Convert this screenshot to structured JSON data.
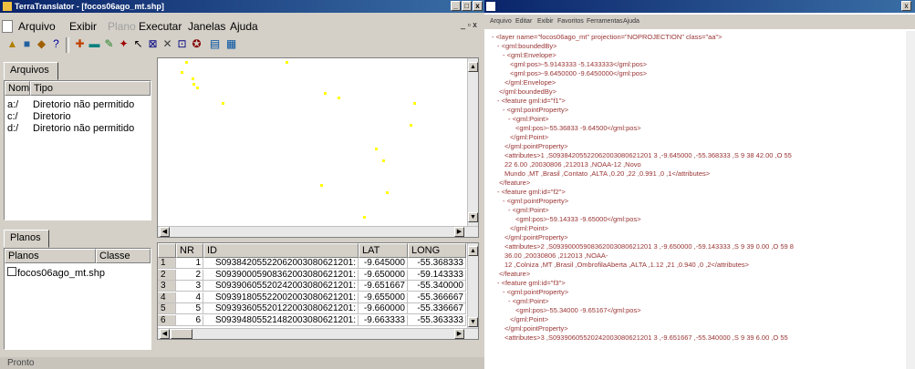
{
  "window": {
    "title": "TerraTranslator - [focos06ago_mt.shp]",
    "btn_min": "_",
    "btn_max": "□",
    "btn_close": "x"
  },
  "menu": {
    "items": [
      "Arquivo",
      "Exibir",
      "Plano",
      "Executar",
      "Janelas",
      "Ajuda"
    ],
    "mdi_controls": "_ ▫ x"
  },
  "toolbar": {
    "icons": [
      "open-icon",
      "save-icon",
      "export-icon",
      "help-icon",
      "zoom-in-icon",
      "zoom-out-icon",
      "pan-icon",
      "pointer-icon",
      "info-icon",
      "select-icon",
      "draw-icon",
      "chart-icon",
      "map-icon"
    ]
  },
  "arquivos": {
    "tab_label": "Arquivos",
    "columns": [
      "Nome",
      "Tipo"
    ],
    "rows": [
      {
        "name": "a:/",
        "type": "Diretorio não permitido"
      },
      {
        "name": "c:/",
        "type": "Diretorio"
      },
      {
        "name": "d:/",
        "type": "Diretorio não permitido"
      }
    ]
  },
  "planos": {
    "tab_label": "Planos",
    "columns": [
      "Planos",
      "Classe"
    ],
    "rows": [
      {
        "name": "focos06ago_mt.shp",
        "class": ""
      }
    ]
  },
  "table": {
    "columns": [
      "NR",
      "ID",
      "LAT",
      "LONG"
    ],
    "rows": [
      {
        "idx": "1",
        "nr": "1",
        "id": "S09384205522062003080621201:",
        "lat": "-9.645000",
        "long": "-55.368333"
      },
      {
        "idx": "2",
        "nr": "2",
        "id": "S09390005908362003080621201:",
        "lat": "-9.650000",
        "long": "-59.143333"
      },
      {
        "idx": "3",
        "nr": "3",
        "id": "S09390605520242003080621201:",
        "lat": "-9.651667",
        "long": "-55.340000"
      },
      {
        "idx": "4",
        "nr": "4",
        "id": "S09391805522002003080621201:",
        "lat": "-9.655000",
        "long": "-55.366667"
      },
      {
        "idx": "5",
        "nr": "5",
        "id": "S09393605520122003080621201:",
        "lat": "-9.660000",
        "long": "-55.336667"
      },
      {
        "idx": "6",
        "nr": "6",
        "id": "S09394805521482003080621201:",
        "lat": "-9.663333",
        "long": "-55.363333"
      }
    ]
  },
  "status": {
    "text": "Pronto"
  },
  "browser": {
    "menu": [
      "Arquivo",
      "Editar",
      "Exibir",
      "Favoritos",
      "Ferramentas",
      "Ajuda"
    ]
  },
  "xml_lines": [
    {
      "ind": 8,
      "text": "- <layer name=\"focos06ago_mt\" projection=\"NOPROJECTION\" class=\"aa\">"
    },
    {
      "ind": 14,
      "text": "- <gml:boundedBy>"
    },
    {
      "ind": 20,
      "text": "- <gml:Envelope>"
    },
    {
      "ind": 28,
      "text": "<gml:pos>-5.9143333 -5.1433333</gml:pos>"
    },
    {
      "ind": 28,
      "text": "<gml:pos>-9.6450000 -9.6450000</gml:pos>"
    },
    {
      "ind": 22,
      "text": "</gml:Envelope>"
    },
    {
      "ind": 16,
      "text": "</gml:boundedBy>"
    },
    {
      "ind": 14,
      "text": "- <feature gml:id=\"f1\">"
    },
    {
      "ind": 20,
      "text": "- <gml:pointProperty>"
    },
    {
      "ind": 26,
      "text": "- <gml:Point>"
    },
    {
      "ind": 34,
      "text": "<gml:pos>-55.36833 -9.64500</gml:pos>"
    },
    {
      "ind": 28,
      "text": "</gml:Point>"
    },
    {
      "ind": 22,
      "text": "</gml:pointProperty>"
    },
    {
      "ind": 22,
      "text": "<attributes>1 ,S09384205522062003080621201 3 ,-9.645000 ,-55.368333 ,S 9 38 42.00 ,O 55"
    },
    {
      "ind": 22,
      "text": "22 6.00 ,20030806 ,212013 ,NOAA-12 ,Novo"
    },
    {
      "ind": 22,
      "text": "Mundo ,MT ,Brasil ,Contato ,ALTA ,0.20 ,22 ,0.991 ,0 ,1</attributes>"
    },
    {
      "ind": 16,
      "text": "</feature>"
    },
    {
      "ind": 14,
      "text": "- <feature gml:id=\"f2\">"
    },
    {
      "ind": 20,
      "text": "- <gml:pointProperty>"
    },
    {
      "ind": 26,
      "text": "- <gml:Point>"
    },
    {
      "ind": 34,
      "text": "<gml:pos>-59.14333 -9.65000</gml:pos>"
    },
    {
      "ind": 28,
      "text": "</gml:Point>"
    },
    {
      "ind": 22,
      "text": "</gml:pointProperty>"
    },
    {
      "ind": 22,
      "text": "<attributes>2 ,S09390005908362003080621201 3 ,-9.650000 ,-59.143333 ,S 9 39 0.00 ,O 59 8"
    },
    {
      "ind": 22,
      "text": "36.00 ,20030806 ,212013 ,NOAA-"
    },
    {
      "ind": 22,
      "text": "12 ,Colniza ,MT ,Brasil ,OmbrofilaAberta ,ALTA ,1.12 ,21 ,0.940 ,0 ,2</attributes>"
    },
    {
      "ind": 16,
      "text": "</feature>"
    },
    {
      "ind": 14,
      "text": "- <feature gml:id=\"f3\">"
    },
    {
      "ind": 20,
      "text": "- <gml:pointProperty>"
    },
    {
      "ind": 26,
      "text": "- <gml:Point>"
    },
    {
      "ind": 34,
      "text": "<gml:pos>-55.34000 -9.65167</gml:pos>"
    },
    {
      "ind": 28,
      "text": "</gml:Point>"
    },
    {
      "ind": 22,
      "text": "</gml:pointProperty>"
    },
    {
      "ind": 22,
      "text": "<attributes>3 ,S09390605520242003080621201 3 ,-9.651667 ,-55.340000 ,S 9 39 6.00 ,O 55"
    }
  ],
  "colors": {
    "titlebar": "#0a246a",
    "window_bg": "#d4d0c8",
    "point": "#ffff00",
    "xml_tag": "#993333",
    "xml_attr": "#cc3300"
  }
}
